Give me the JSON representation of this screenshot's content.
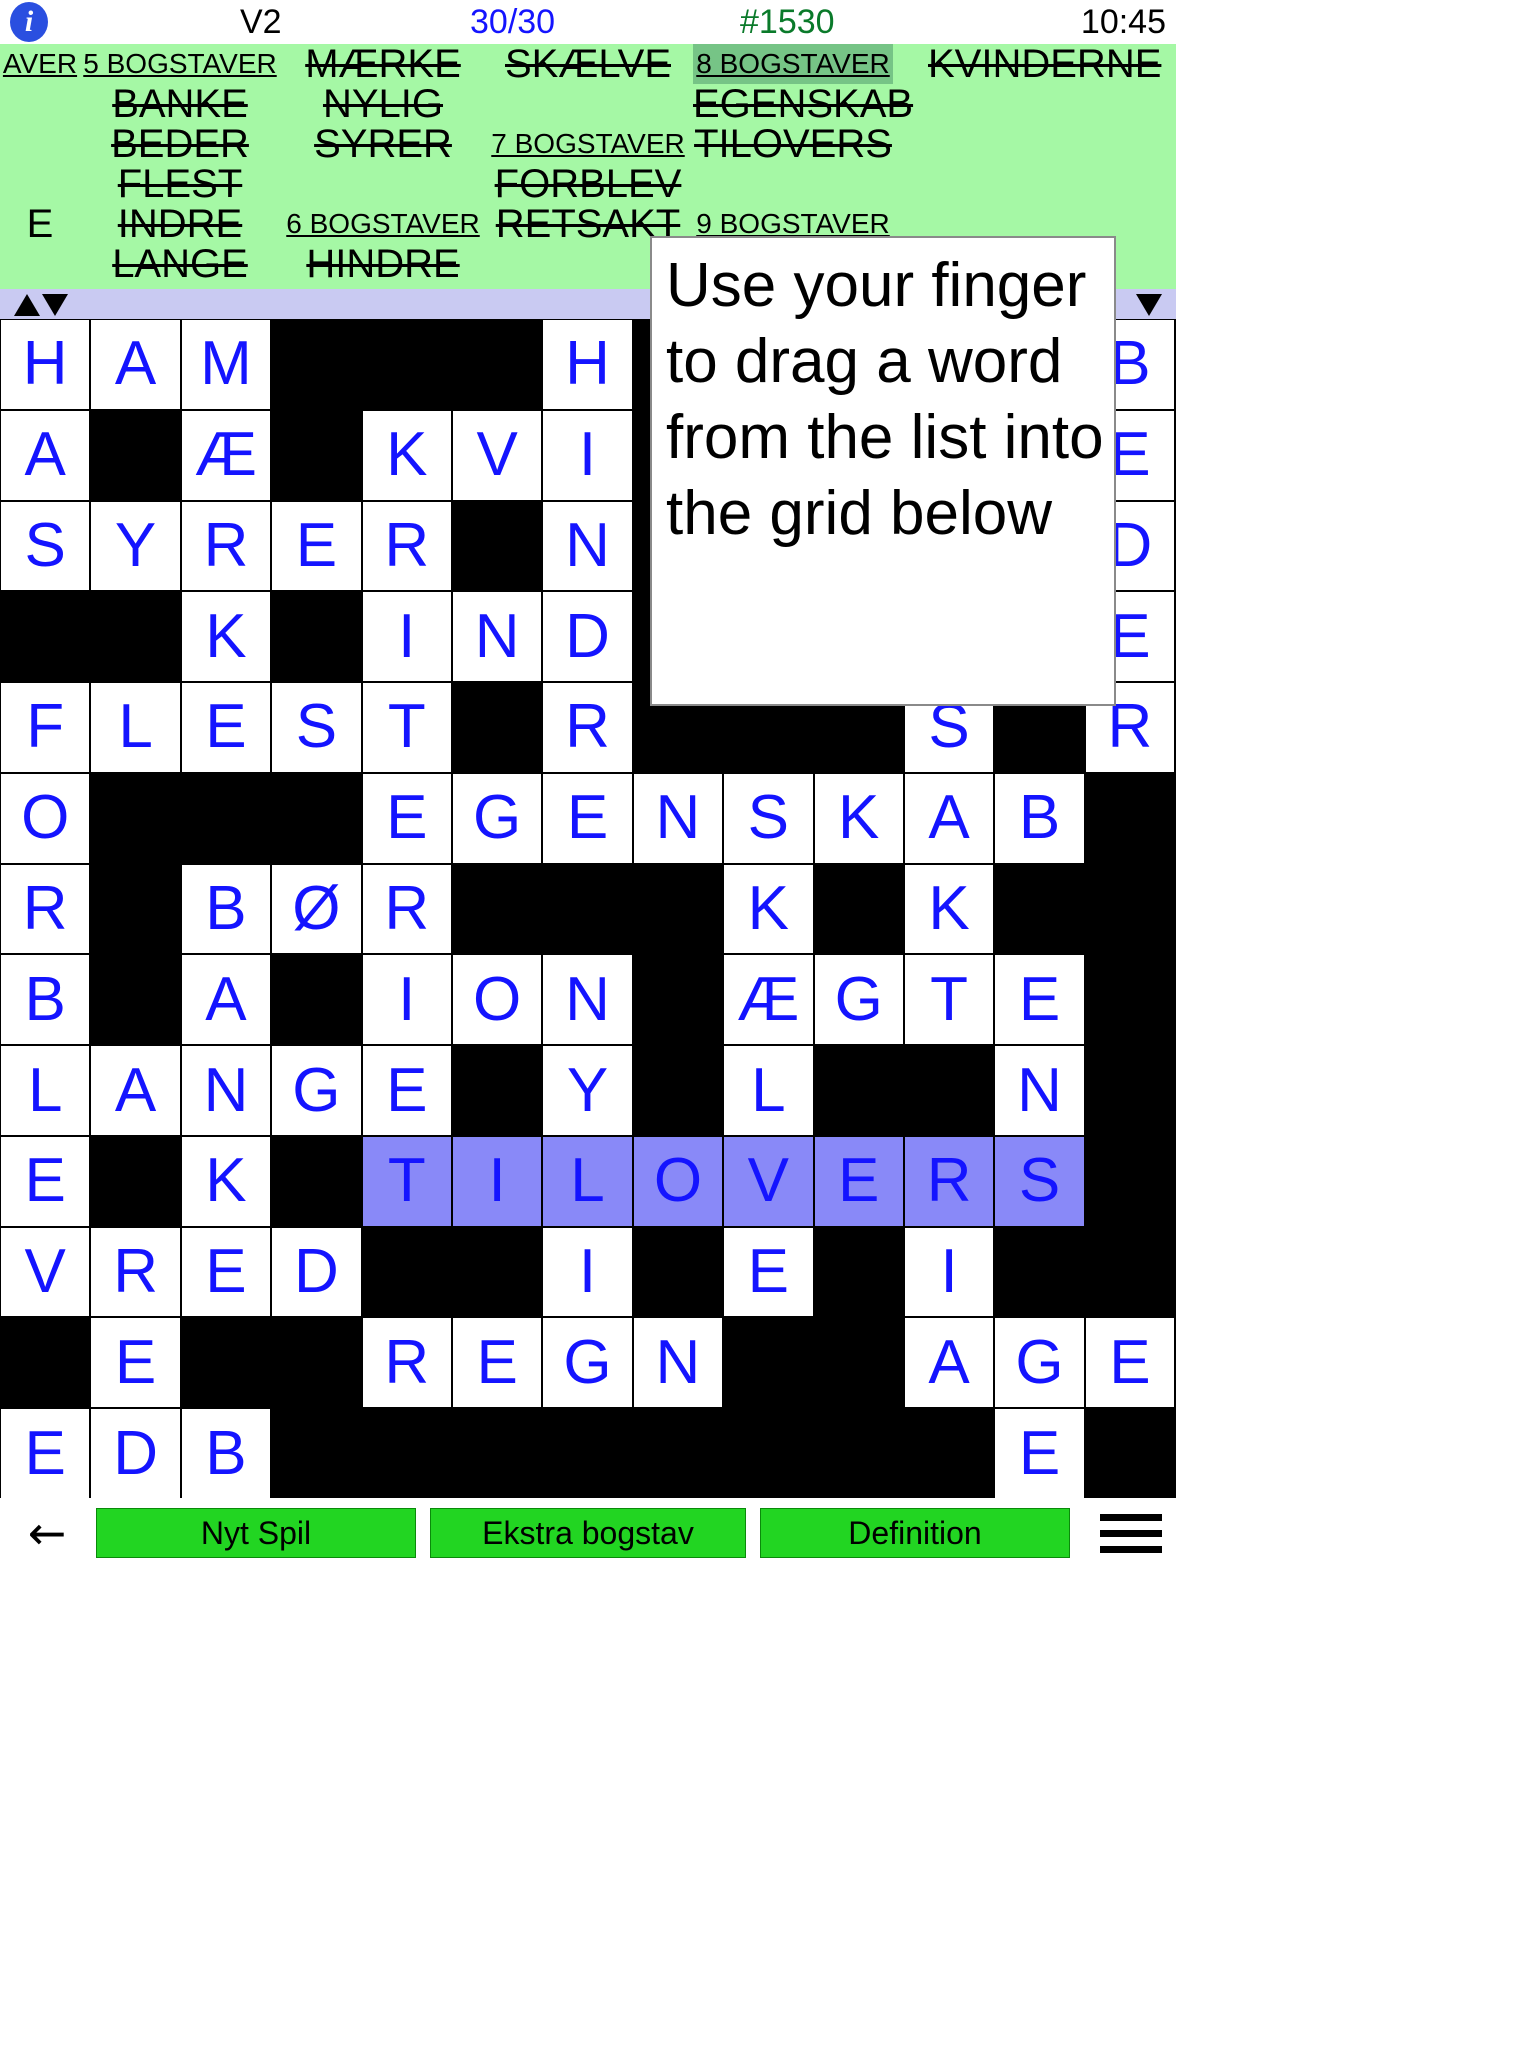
{
  "statusbar": {
    "info_icon": "info-icon",
    "version": "V2",
    "progress": "30/30",
    "puzzle_number": "#1530",
    "clock": "10:45",
    "colors": {
      "progress": "#1414ff",
      "puzzle": "#0a7a2a"
    }
  },
  "wordlist": {
    "background": "#a5f8a5",
    "selected_header_background": "#76c486",
    "columns": [
      {
        "entries": [
          {
            "text": "AVER",
            "type": "header",
            "selected": false,
            "struck": false
          },
          {
            "text": "",
            "type": "word",
            "struck": false
          },
          {
            "text": "",
            "type": "word",
            "struck": false
          },
          {
            "text": "",
            "type": "word",
            "struck": false
          },
          {
            "text": "E",
            "type": "word",
            "struck": false
          },
          {
            "text": "",
            "type": "word",
            "struck": false
          }
        ]
      },
      {
        "entries": [
          {
            "text": "5 BOGSTAVER",
            "type": "header",
            "selected": false
          },
          {
            "text": "BANKE",
            "type": "word",
            "struck": true
          },
          {
            "text": "BEDER",
            "type": "word",
            "struck": true
          },
          {
            "text": "FLEST",
            "type": "word",
            "struck": true
          },
          {
            "text": "INDRE",
            "type": "word",
            "struck": true
          },
          {
            "text": "LANGE",
            "type": "word",
            "struck": true
          }
        ]
      },
      {
        "entries": [
          {
            "text": "MÆRKE",
            "type": "word",
            "struck": true
          },
          {
            "text": "NYLIG",
            "type": "word",
            "struck": true
          },
          {
            "text": "SYRER",
            "type": "word",
            "struck": true
          },
          {
            "text": "",
            "type": "word",
            "struck": false
          },
          {
            "text": "6 BOGSTAVER",
            "type": "header",
            "selected": false
          },
          {
            "text": "HINDRE",
            "type": "word",
            "struck": true
          }
        ]
      },
      {
        "entries": [
          {
            "text": "SKÆLVE",
            "type": "word",
            "struck": true
          },
          {
            "text": "",
            "type": "word",
            "struck": false
          },
          {
            "text": "7 BOGSTAVER",
            "type": "header",
            "selected": false
          },
          {
            "text": "FORBLEV",
            "type": "word",
            "struck": true
          },
          {
            "text": "RETSAKT",
            "type": "word",
            "struck": true
          },
          {
            "text": "",
            "type": "word",
            "struck": false
          }
        ]
      },
      {
        "entries": [
          {
            "text": "8 BOGSTAVER",
            "type": "header",
            "selected": true
          },
          {
            "text": "EGENSKAB",
            "type": "word",
            "struck": true
          },
          {
            "text": "TILOVERS",
            "type": "word",
            "struck": true
          },
          {
            "text": "",
            "type": "word",
            "struck": false
          },
          {
            "text": "9 BOGSTAVER",
            "type": "header",
            "selected": false
          },
          {
            "text": "",
            "type": "word",
            "struck": false
          }
        ]
      },
      {
        "entries": [
          {
            "text": "KVINDERNE",
            "type": "word",
            "struck": true
          },
          {
            "text": "",
            "type": "word",
            "struck": false
          },
          {
            "text": "",
            "type": "word",
            "struck": false
          },
          {
            "text": "",
            "type": "word",
            "struck": false
          },
          {
            "text": "",
            "type": "word",
            "struck": false
          },
          {
            "text": "",
            "type": "word",
            "struck": false
          }
        ]
      }
    ]
  },
  "divider": {
    "background": "#c9caf2",
    "scroll_up": "triangle-up",
    "scroll_down": "triangle-down",
    "scroll_down_right": "triangle-down"
  },
  "tooltip": {
    "text": "Use your finger to drag a word from the list into the grid below"
  },
  "grid": {
    "rows": 13,
    "cols": 13,
    "letter_color": "#1414ff",
    "highlight_color": "#8989f8",
    "cells": [
      [
        "H",
        "A",
        "M",
        "#",
        "#",
        "#",
        "H",
        "#",
        "#",
        "#",
        "#",
        "#",
        "B"
      ],
      [
        "A",
        "#",
        "Æ",
        "#",
        "K",
        "V",
        "I",
        "#",
        "#",
        "#",
        "#",
        "#",
        "E"
      ],
      [
        "S",
        "Y",
        "R",
        "E",
        "R",
        "#",
        "N",
        "#",
        "#",
        "#",
        "#",
        "#",
        "D"
      ],
      [
        "#",
        "#",
        "K",
        "#",
        "I",
        "N",
        "D",
        "#",
        "#",
        "#",
        "#",
        "#",
        "E"
      ],
      [
        "F",
        "L",
        "E",
        "S",
        "T",
        "#",
        "R",
        "#",
        "#",
        "#",
        "S",
        "#",
        "R"
      ],
      [
        "O",
        "#",
        "#",
        "#",
        "E",
        "G",
        "E",
        "N",
        "S",
        "K",
        "A",
        "B",
        "#"
      ],
      [
        "R",
        "#",
        "B",
        "Ø",
        "R",
        "#",
        "#",
        "#",
        "K",
        "#",
        "K",
        "#",
        "#"
      ],
      [
        "B",
        "#",
        "A",
        "#",
        "I",
        "O",
        "N",
        "#",
        "Æ",
        "G",
        "T",
        "E",
        "#"
      ],
      [
        "L",
        "A",
        "N",
        "G",
        "E",
        "#",
        "Y",
        "#",
        "L",
        "#",
        "#",
        "N",
        "#"
      ],
      [
        "E",
        "#",
        "K",
        "#",
        "T",
        "I",
        "L",
        "O",
        "V",
        "E",
        "R",
        "S",
        "#"
      ],
      [
        "V",
        "R",
        "E",
        "D",
        "#",
        "#",
        "I",
        "#",
        "E",
        "#",
        "I",
        "#",
        "#"
      ],
      [
        "#",
        "E",
        "#",
        "#",
        "R",
        "E",
        "G",
        "N",
        "#",
        "#",
        "A",
        "G",
        "E"
      ],
      [
        "E",
        "D",
        "B",
        "#",
        "#",
        "#",
        "#",
        "#",
        "#",
        "#",
        "#",
        "E",
        "#"
      ]
    ],
    "highlighted_cells": [
      [
        9,
        4
      ],
      [
        9,
        5
      ],
      [
        9,
        6
      ],
      [
        9,
        7
      ],
      [
        9,
        8
      ],
      [
        9,
        9
      ],
      [
        9,
        10
      ],
      [
        9,
        11
      ]
    ]
  },
  "bottombar": {
    "back_arrow": "arrow-left-icon",
    "buttons": [
      {
        "label": "Nyt Spil",
        "name": "new-game-button"
      },
      {
        "label": "Ekstra bogstav",
        "name": "extra-letter-button"
      },
      {
        "label": "Definition",
        "name": "definition-button"
      }
    ],
    "menu_icon": "hamburger-menu-icon",
    "button_color": "#22d522"
  }
}
